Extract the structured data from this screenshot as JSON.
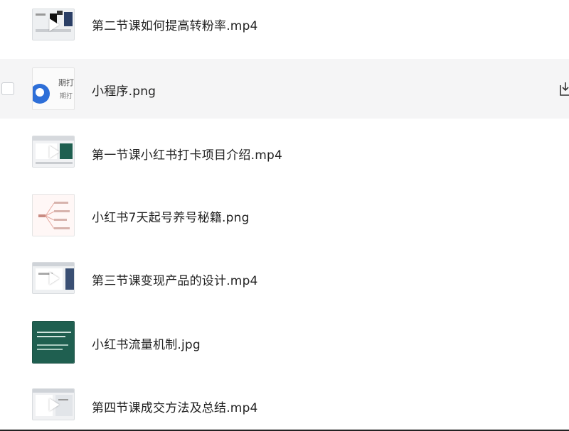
{
  "files": [
    {
      "name": "第二节课如何提高转粉率.mp4",
      "type": "video"
    },
    {
      "name": "小程序.png",
      "type": "image",
      "thumb_text": [
        "期打",
        "期打"
      ]
    },
    {
      "name": "第一节课小红书打卡项目介绍.mp4",
      "type": "video"
    },
    {
      "name": "小红书7天起号养号秘籍.png",
      "type": "image"
    },
    {
      "name": "第三节课变现产品的设计.mp4",
      "type": "video"
    },
    {
      "name": "小红书流量机制.jpg",
      "type": "image"
    },
    {
      "name": "第四节课成交方法及总结.mp4",
      "type": "video"
    }
  ],
  "colors": {
    "hover_row": "#f5f5f6",
    "text": "#222222",
    "accent_blue": "#2e6fd8",
    "slide_green": "#1f5f50"
  },
  "icons": {
    "download": "download-icon",
    "play": "play-icon"
  }
}
